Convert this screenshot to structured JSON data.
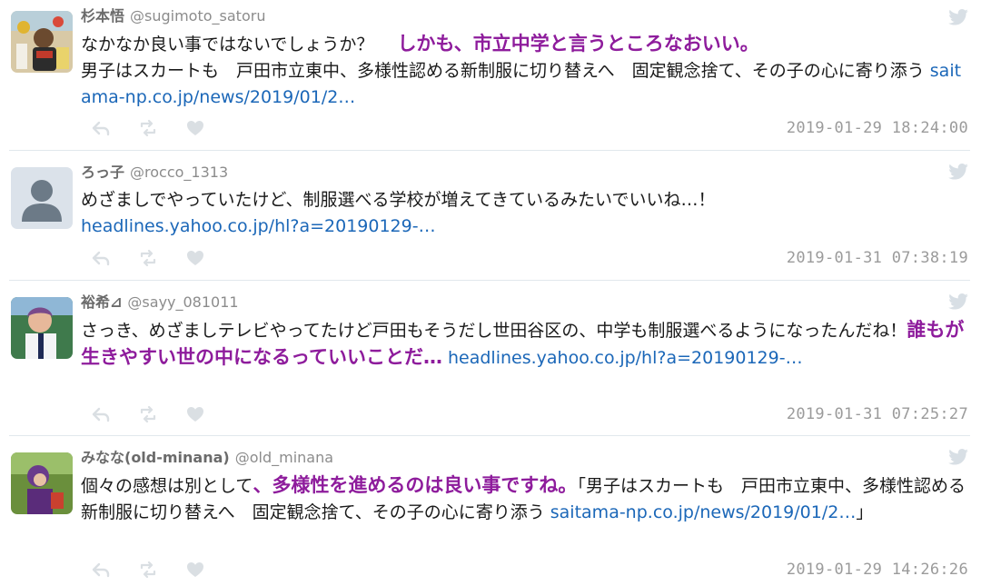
{
  "tweets": [
    {
      "name": "杉本悟",
      "handle": "@sugimoto_satoru",
      "parts": [
        {
          "text": "なかなか良い事ではないでしょうか？",
          "style": "normal"
        },
        {
          "text": "",
          "style": "space"
        },
        {
          "text": "しかも、市立中学と言うところなおいい。",
          "style": "highlight"
        },
        {
          "text": "男子はスカートも　戸田市立東中、多様性認める新制服に切り替えへ　固定観念捨て、その子の心に寄り添う",
          "style": "normal",
          "newline": true
        },
        {
          "text": " saitama-np.co.jp/news/2019/01/2…",
          "style": "link"
        }
      ],
      "timestamp": "2019-01-29 18:24:00"
    },
    {
      "name": "ろっ子",
      "handle": "@rocco_1313",
      "parts": [
        {
          "text": "めざましでやっていたけど、制服選べる学校が増えてきているみたいでいいね…！",
          "style": "normal"
        },
        {
          "text": "headlines.yahoo.co.jp/hl?a=20190129-…",
          "style": "link",
          "newline": true
        }
      ],
      "timestamp": "2019-01-31 07:38:19"
    },
    {
      "name": "裕希⊿",
      "handle": "@sayy_081011",
      "parts": [
        {
          "text": "さっき、めざましテレビやってたけど戸田もそうだし世田谷区の、中学も制服選べるようになったんだね！",
          "style": "normal"
        },
        {
          "text": "誰もが生きやすい世の中になるっていいことだ…",
          "style": "highlight"
        },
        {
          "text": " headlines.yahoo.co.jp/hl?a=20190129-…",
          "style": "link"
        }
      ],
      "timestamp": "2019-01-31 07:25:27"
    },
    {
      "name": "みなな(old-minana)",
      "handle": "@old_minana",
      "parts": [
        {
          "text": "個々の感想は別として",
          "style": "normal"
        },
        {
          "text": "、多様性を進めるのは良い事ですね。",
          "style": "highlight"
        },
        {
          "text": "「男子はスカートも　戸田市立東中、多様性認める新制服に切り替えへ　固定観念捨て、その子の心に寄り添う ",
          "style": "normal"
        },
        {
          "text": "saitama-np.co.jp/news/2019/01/2…",
          "style": "link"
        },
        {
          "text": "」",
          "style": "normal"
        }
      ],
      "timestamp": "2019-01-29 14:26:26"
    }
  ],
  "icons": {
    "bird": "twitter-bird-icon",
    "reply": "reply-icon",
    "retweet": "retweet-icon",
    "like": "heart-icon"
  },
  "colors": {
    "highlight": "#8e1c9c",
    "link": "#1b67b8",
    "name": "#6b6b6b",
    "meta": "#9b9b9b",
    "divider": "#e1e8ed"
  }
}
